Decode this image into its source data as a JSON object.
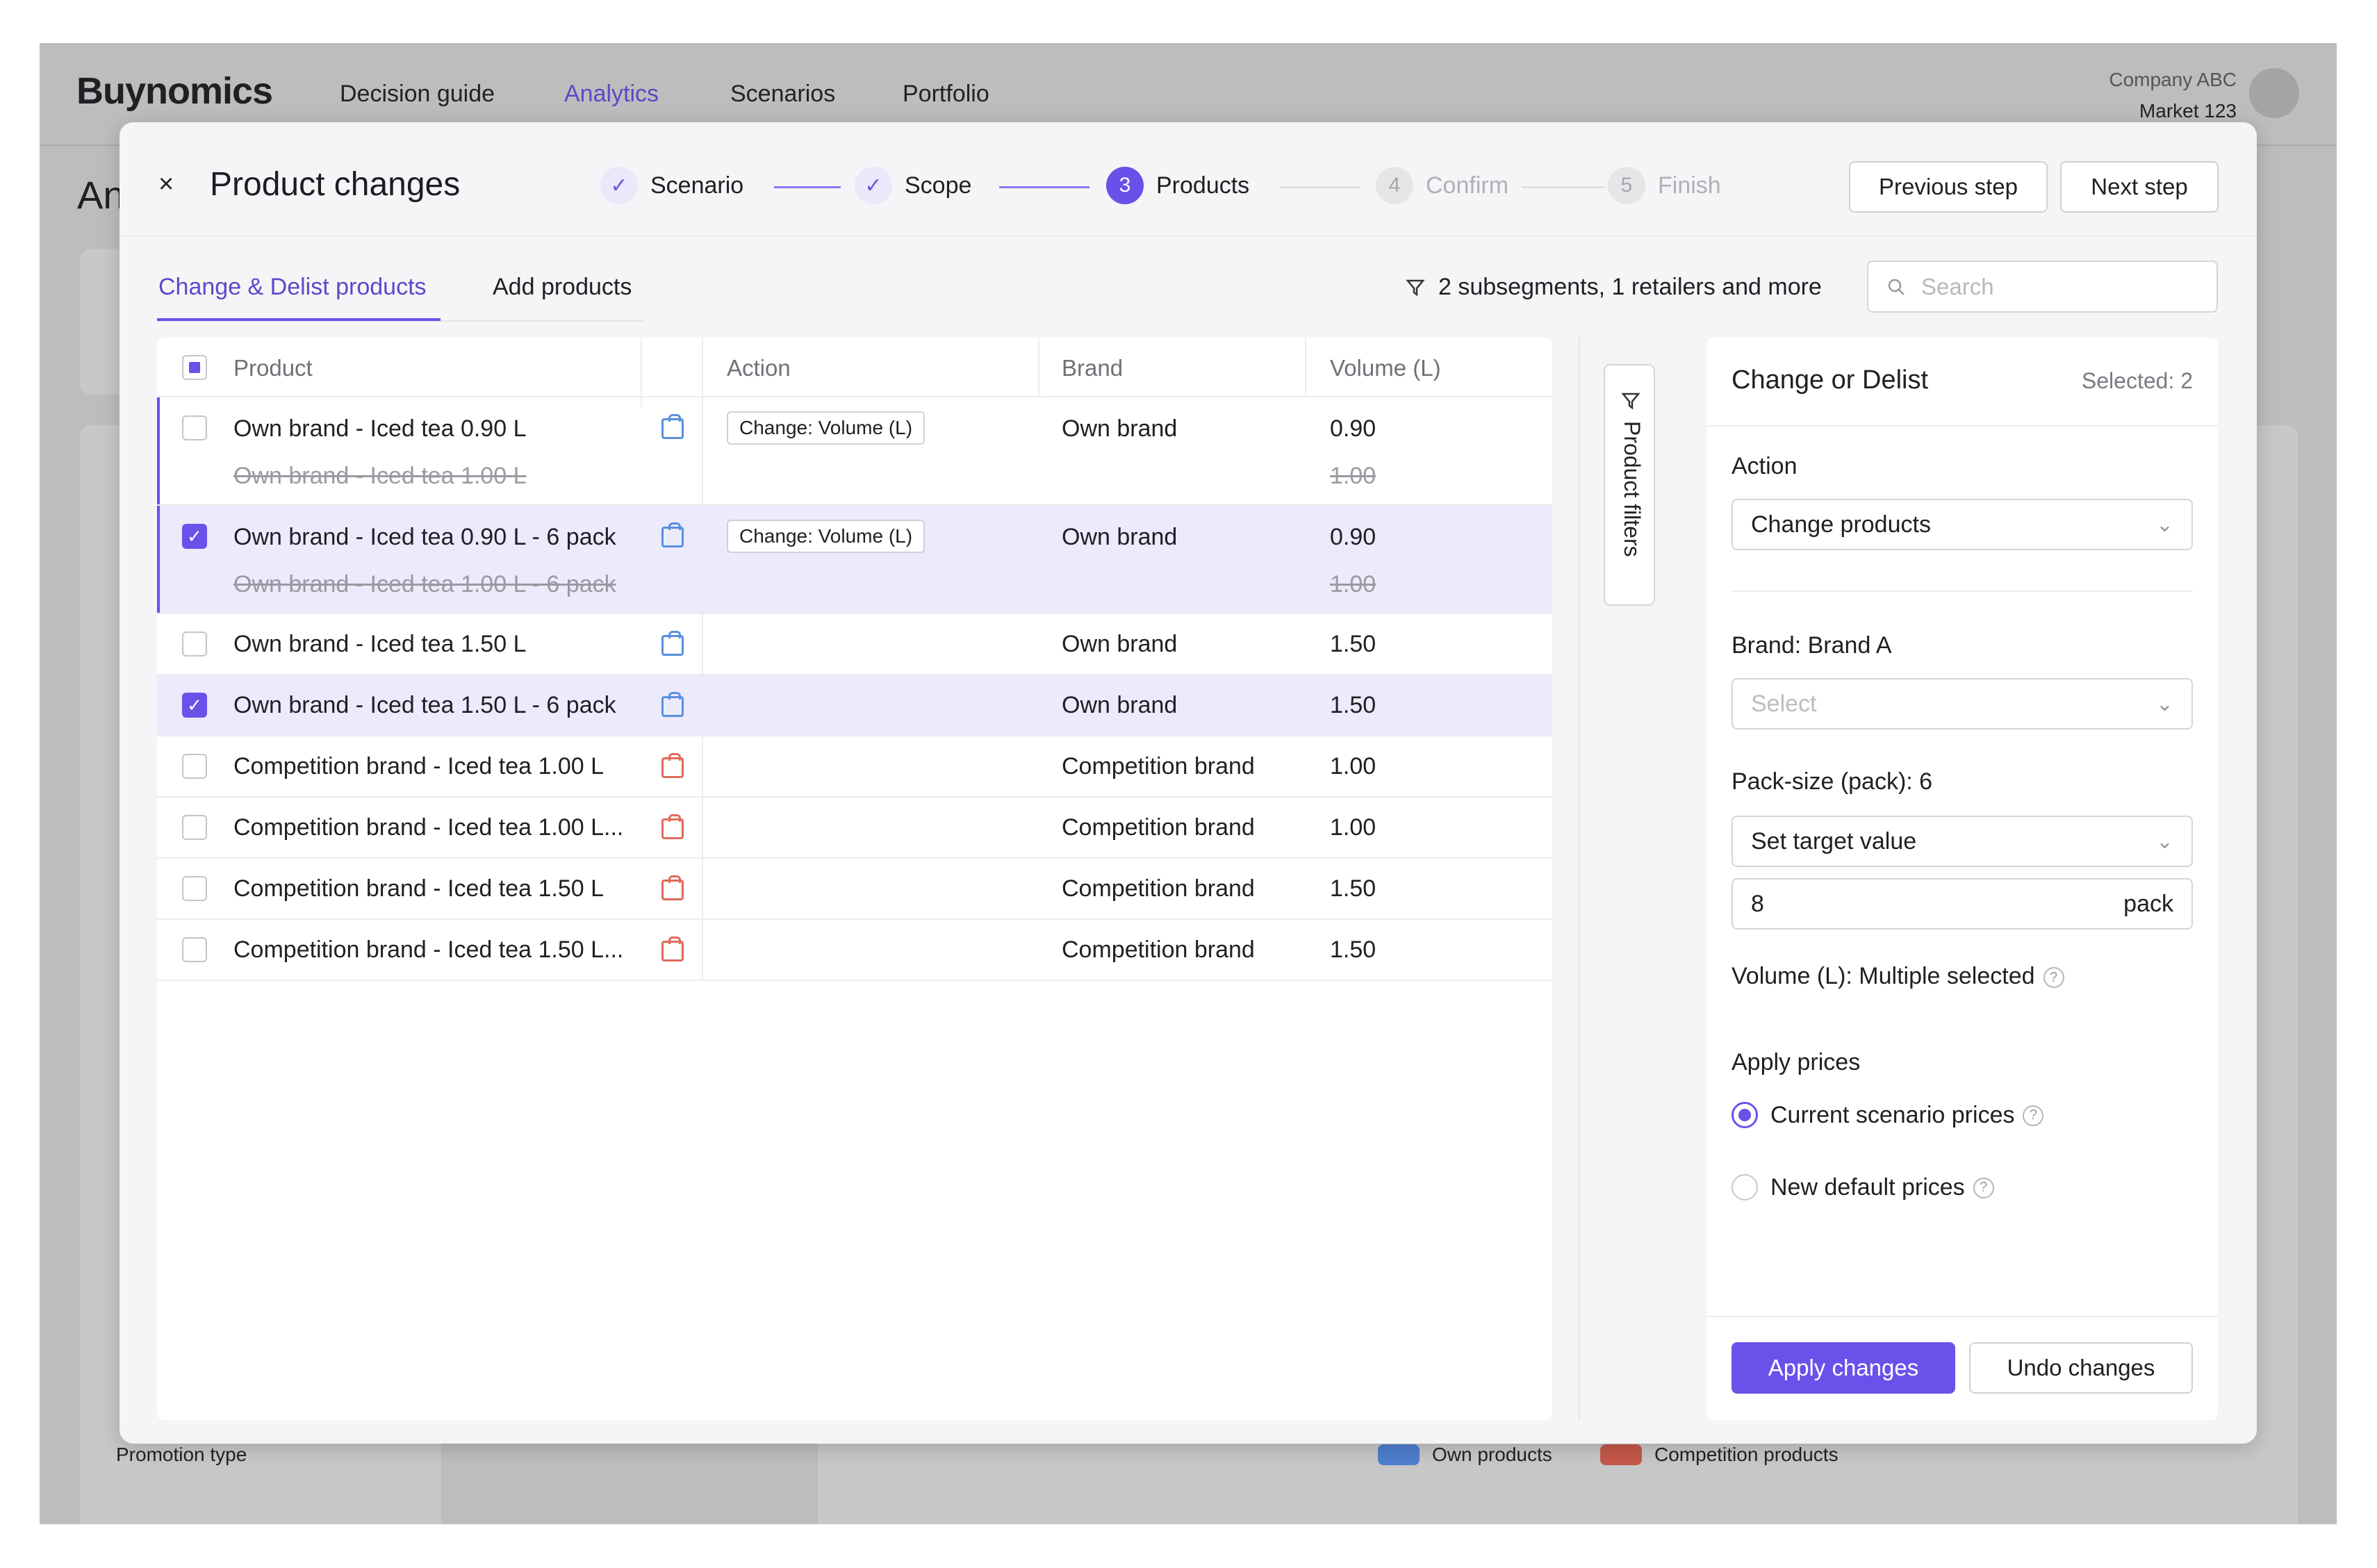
{
  "app": {
    "logo": "Buynomics",
    "nav": [
      "Decision guide",
      "Analytics",
      "Scenarios",
      "Portfolio"
    ],
    "company": "Company ABC",
    "market": "Market 123",
    "bg_title": "An",
    "bg_legend": {
      "own": "Own products",
      "competition": "Competition products"
    },
    "bg_promo": "Promotion type"
  },
  "modal": {
    "title": "Product changes",
    "close": "×",
    "steps": [
      {
        "num": "✓",
        "label": "Scenario"
      },
      {
        "num": "✓",
        "label": "Scope"
      },
      {
        "num": "3",
        "label": "Products"
      },
      {
        "num": "4",
        "label": "Confirm"
      },
      {
        "num": "5",
        "label": "Finish"
      }
    ],
    "prev_label": "Previous step",
    "next_label": "Next step",
    "tabs": [
      "Change & Delist products",
      "Add products"
    ],
    "filter_summary": "2 subsegments, 1 retailers and more",
    "search_placeholder": "Search",
    "columns": [
      "Product",
      "Action",
      "Brand",
      "Volume (L)"
    ],
    "rows": [
      {
        "product": "Own brand - Iced tea 0.90 L",
        "old_product": "Own brand - Iced tea 1.00 L",
        "action": "Change: Volume (L)",
        "brand": "Own brand",
        "volume": "0.90",
        "old_volume": "1.00",
        "checked": false
      },
      {
        "product": "Own brand - Iced tea 0.90 L - 6 pack",
        "old_product": "Own brand - Iced tea 1.00 L - 6 pack",
        "action": "Change: Volume (L)",
        "brand": "Own brand",
        "volume": "0.90",
        "old_volume": "1.00",
        "checked": true
      },
      {
        "product": "Own brand - Iced tea 1.50 L",
        "brand": "Own brand",
        "volume": "1.50",
        "checked": false
      },
      {
        "product": "Own brand - Iced tea 1.50 L - 6 pack",
        "brand": "Own brand",
        "volume": "1.50",
        "checked": true
      },
      {
        "product": "Competition brand - Iced tea 1.00 L",
        "brand": "Competition brand",
        "volume": "1.00",
        "checked": false
      },
      {
        "product": "Competition brand - Iced tea 1.00 L...",
        "brand": "Competition brand",
        "volume": "1.00",
        "checked": false
      },
      {
        "product": "Competition brand - Iced tea 1.50 L",
        "brand": "Competition brand",
        "volume": "1.50",
        "checked": false
      },
      {
        "product": "Competition brand - Iced tea 1.50 L...",
        "brand": "Competition brand",
        "volume": "1.50",
        "checked": false
      }
    ],
    "product_filters": "Product filters",
    "side": {
      "title": "Change or Delist",
      "selected": "Selected: 2",
      "action_label": "Action",
      "action_value": "Change products",
      "brand_label": "Brand: Brand A",
      "brand_placeholder": "Select",
      "pack_label": "Pack-size (pack): 6",
      "pack_mode": "Set target value",
      "pack_value": "8",
      "pack_unit": "pack",
      "volume_label": "Volume (L): Multiple selected",
      "apply_prices_label": "Apply prices",
      "radio_current": "Current scenario prices",
      "radio_new": "New default prices",
      "apply_btn": "Apply changes",
      "undo_btn": "Undo changes"
    }
  },
  "colors": {
    "accent": "#6b50ea",
    "own": "#5a8fe0",
    "competition": "#e06a5a"
  }
}
